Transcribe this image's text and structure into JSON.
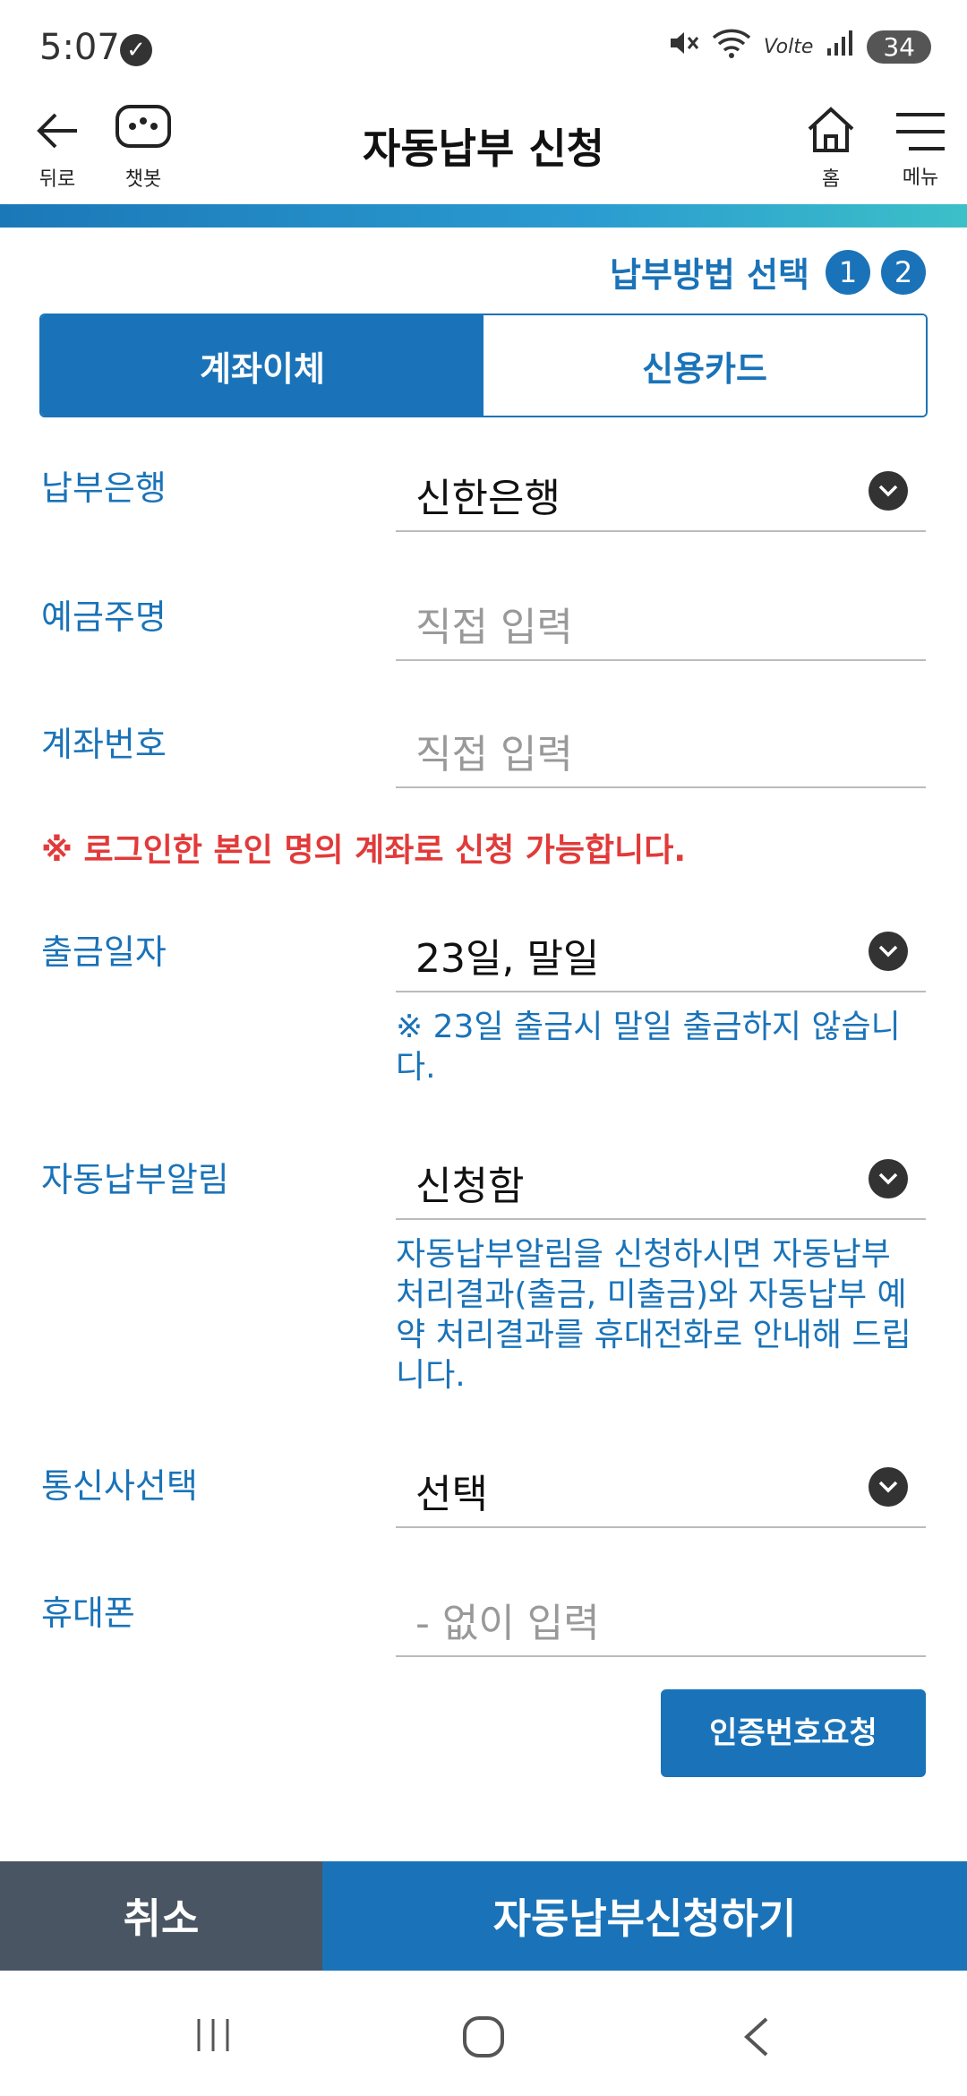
{
  "status": {
    "time": "5:07",
    "battery": "34",
    "lte": "Volte"
  },
  "header": {
    "back_label": "뒤로",
    "chatbot_label": "챗봇",
    "title": "자동납부 신청",
    "home_label": "홈",
    "menu_label": "메뉴"
  },
  "steps": {
    "label": "납부방법 선택",
    "step1": "1",
    "step2": "2"
  },
  "tabs": {
    "bank": "계좌이체",
    "card": "신용카드"
  },
  "form": {
    "bank_label": "납부은행",
    "bank_value": "신한은행",
    "holder_label": "예금주명",
    "holder_placeholder": "직접 입력",
    "account_label": "계좌번호",
    "account_placeholder": "직접 입력",
    "warning": "※ 로그인한 본인 명의 계좌로 신청 가능합니다.",
    "date_label": "출금일자",
    "date_value": "23일, 말일",
    "date_note": "※ 23일 출금시 말일 출금하지 않습니다.",
    "notify_label": "자동납부알림",
    "notify_value": "신청함",
    "notify_note": "자동납부알림을 신청하시면 자동납부 처리결과(출금, 미출금)와 자동납부 예약 처리결과를 휴대전화로 안내해 드립니다.",
    "carrier_label": "통신사선택",
    "carrier_value": "선택",
    "phone_label": "휴대폰",
    "phone_placeholder": "- 없이 입력",
    "verify_button": "인증번호요청"
  },
  "bottom": {
    "cancel": "취소",
    "submit": "자동납부신청하기"
  }
}
